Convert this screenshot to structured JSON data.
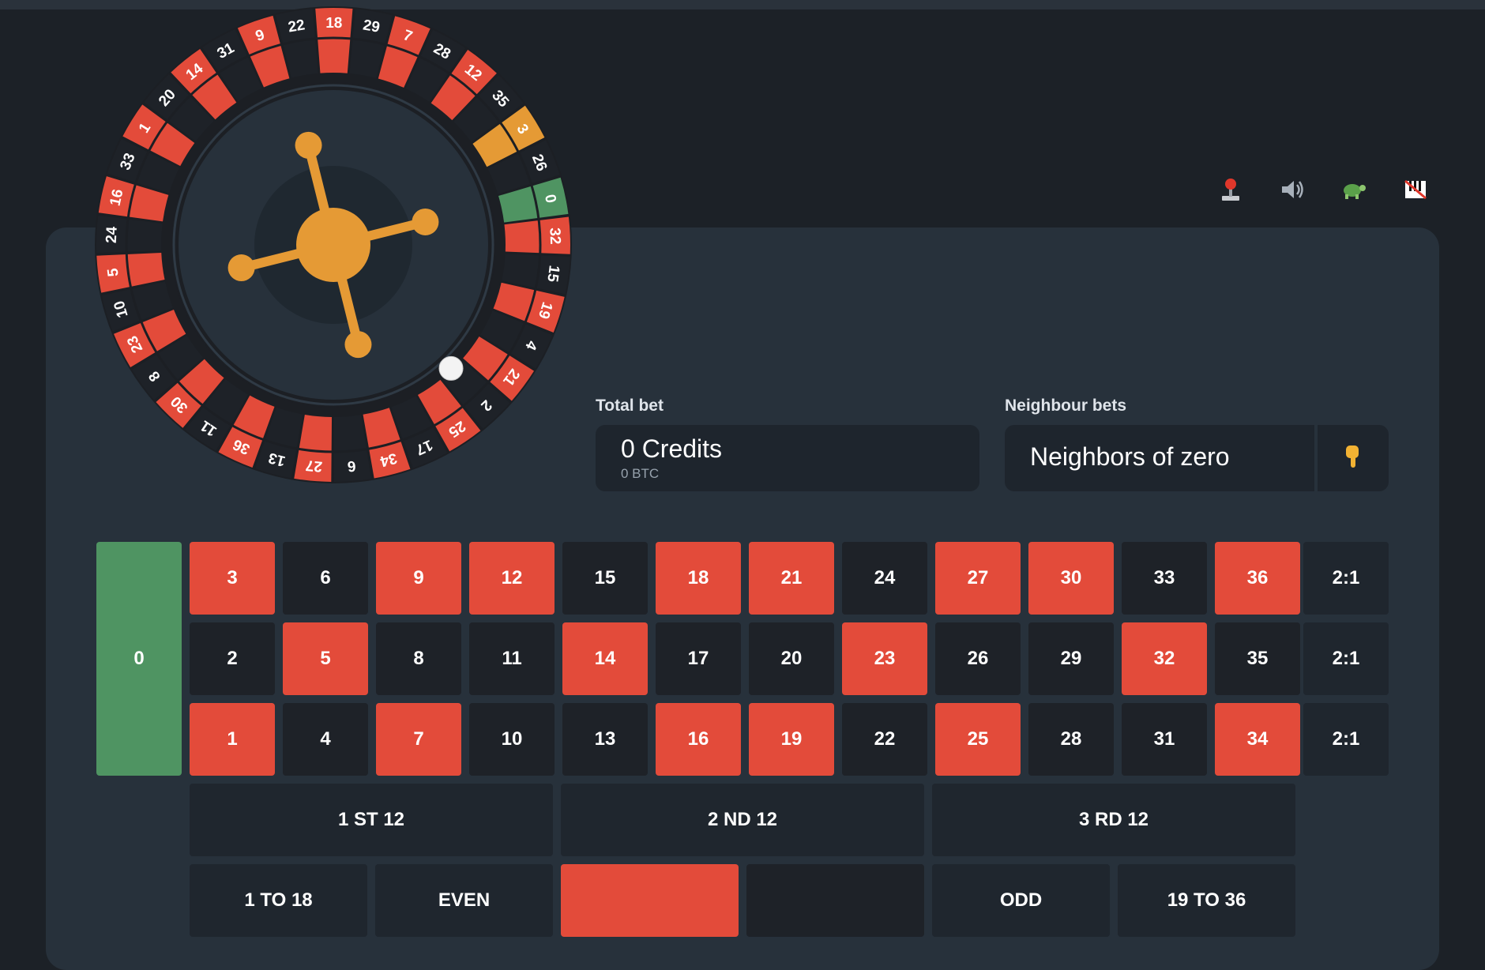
{
  "wheel": {
    "sequence": [
      0,
      32,
      15,
      19,
      4,
      21,
      2,
      25,
      17,
      34,
      6,
      27,
      13,
      36,
      11,
      30,
      8,
      23,
      10,
      5,
      24,
      16,
      33,
      1,
      20,
      14,
      31,
      9,
      22,
      18,
      29,
      7,
      28,
      12,
      35,
      3,
      26
    ],
    "red_numbers": [
      1,
      3,
      5,
      7,
      9,
      12,
      14,
      16,
      18,
      19,
      21,
      23,
      25,
      27,
      30,
      32,
      34,
      36
    ],
    "highlighted_number": 3,
    "ball_on_number": 2,
    "colors": {
      "red": "#e34b3a",
      "black": "#1e2228",
      "green": "#4f9462",
      "highlight": "#e59a35",
      "hub": "#e59a35"
    }
  },
  "toolbar": {
    "icons": [
      "joystick-icon",
      "speaker-icon",
      "turtle-icon",
      "piano-off-icon"
    ]
  },
  "total_bet": {
    "label": "Total bet",
    "credits": "0 Credits",
    "btc": "0 BTC"
  },
  "neighbour_bets": {
    "label": "Neighbour bets",
    "value": "Neighbors of zero",
    "button_icon": "pointing-down-icon"
  },
  "table": {
    "zero": "0",
    "rows": [
      [
        "3",
        "6",
        "9",
        "12",
        "15",
        "18",
        "21",
        "24",
        "27",
        "30",
        "33",
        "36"
      ],
      [
        "2",
        "5",
        "8",
        "11",
        "14",
        "17",
        "20",
        "23",
        "26",
        "29",
        "32",
        "35"
      ],
      [
        "1",
        "4",
        "7",
        "10",
        "13",
        "16",
        "19",
        "22",
        "25",
        "28",
        "31",
        "34"
      ]
    ],
    "column_bets": [
      "2:1",
      "2:1",
      "2:1"
    ],
    "dozens": [
      "1 ST 12",
      "2 ND 12",
      "3 RD 12"
    ],
    "outside": {
      "low": "1 TO 18",
      "even": "EVEN",
      "red": "",
      "black": "",
      "odd": "ODD",
      "high": "19 TO 36"
    }
  }
}
